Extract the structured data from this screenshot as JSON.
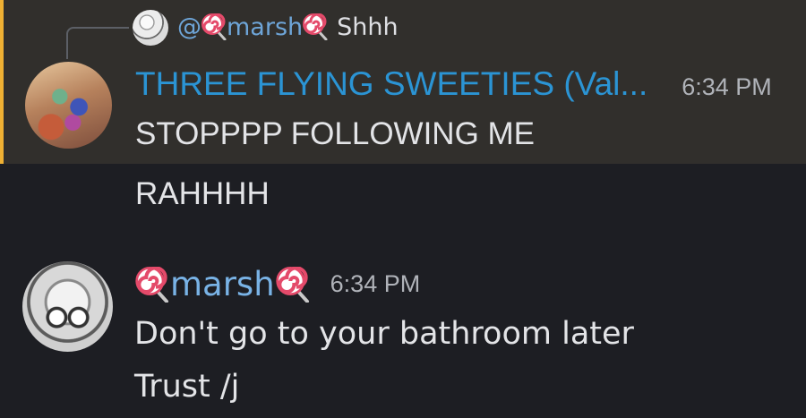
{
  "reply": {
    "mention_prefix": "@",
    "mention_name": "marsh",
    "text": "Shhh"
  },
  "message_group_1": {
    "author": "THREE FLYING SWEETIES (Val...",
    "timestamp": "6:34 PM",
    "messages": [
      "STOPPPP FOLLOWING ME",
      "RAHHHH"
    ],
    "highlight_color": "#efb033",
    "author_color": "#2b94d4"
  },
  "message_group_2": {
    "author": "marsh",
    "timestamp": "6:34 PM",
    "messages": [
      "Don't go to your bathroom later",
      "Trust /j"
    ],
    "author_color": "#79b3e6"
  },
  "icons": {
    "name_decoration": "lollipop-icon"
  }
}
